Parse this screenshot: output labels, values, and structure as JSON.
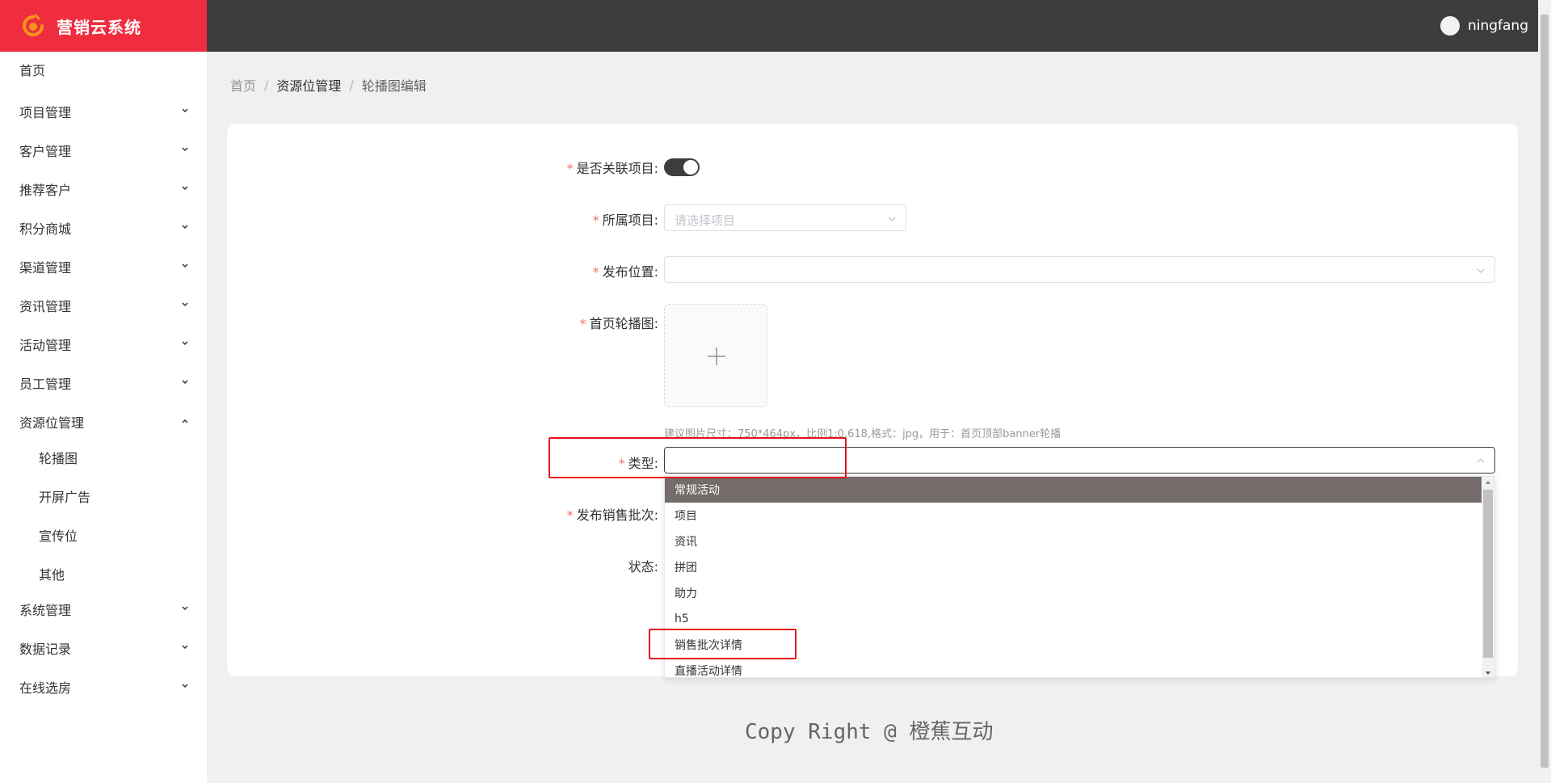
{
  "header": {
    "app_title": "营销云系统",
    "username": "ningfang"
  },
  "sidebar": {
    "items": [
      {
        "label": "首页"
      },
      {
        "label": "项目管理"
      },
      {
        "label": "客户管理"
      },
      {
        "label": "推荐客户"
      },
      {
        "label": "积分商城"
      },
      {
        "label": "渠道管理"
      },
      {
        "label": "资讯管理"
      },
      {
        "label": "活动管理"
      },
      {
        "label": "员工管理"
      },
      {
        "label": "资源位管理"
      },
      {
        "label": "系统管理"
      },
      {
        "label": "数据记录"
      },
      {
        "label": "在线选房"
      }
    ],
    "sub_items": [
      {
        "label": "轮播图"
      },
      {
        "label": "开屏广告"
      },
      {
        "label": "宣传位"
      },
      {
        "label": "其他"
      }
    ]
  },
  "breadcrumb": {
    "home": "首页",
    "section": "资源位管理",
    "current": "轮播图编辑",
    "separator": "/"
  },
  "form": {
    "related_label": "是否关联项目:",
    "related_on": true,
    "project_label": "所属项目:",
    "project_placeholder": "请选择项目",
    "position_label": "发布位置:",
    "banner_label": "首页轮播图:",
    "banner_hint": "建议图片尺寸：750*464px，比例1:0.618,格式：jpg，用于：首页顶部banner轮播",
    "type_label": "类型:",
    "batch_label": "发布销售批次:",
    "status_label": "状态:",
    "required_mark": "*"
  },
  "type_dropdown": {
    "highlighted": "常规活动",
    "options": [
      {
        "label": "常规活动"
      },
      {
        "label": "项目"
      },
      {
        "label": "资讯"
      },
      {
        "label": "拼团"
      },
      {
        "label": "助力"
      },
      {
        "label": "h5"
      },
      {
        "label": "销售批次详情"
      },
      {
        "label": "直播活动详情"
      }
    ]
  },
  "footer": {
    "copyright": "Copy Right @ 橙蕉互动"
  },
  "colors": {
    "brand_red": "#f02d3e",
    "topbar": "#3d3d3d",
    "highlight_box": "#e8101b",
    "selected_option_bg": "#736c6a"
  }
}
